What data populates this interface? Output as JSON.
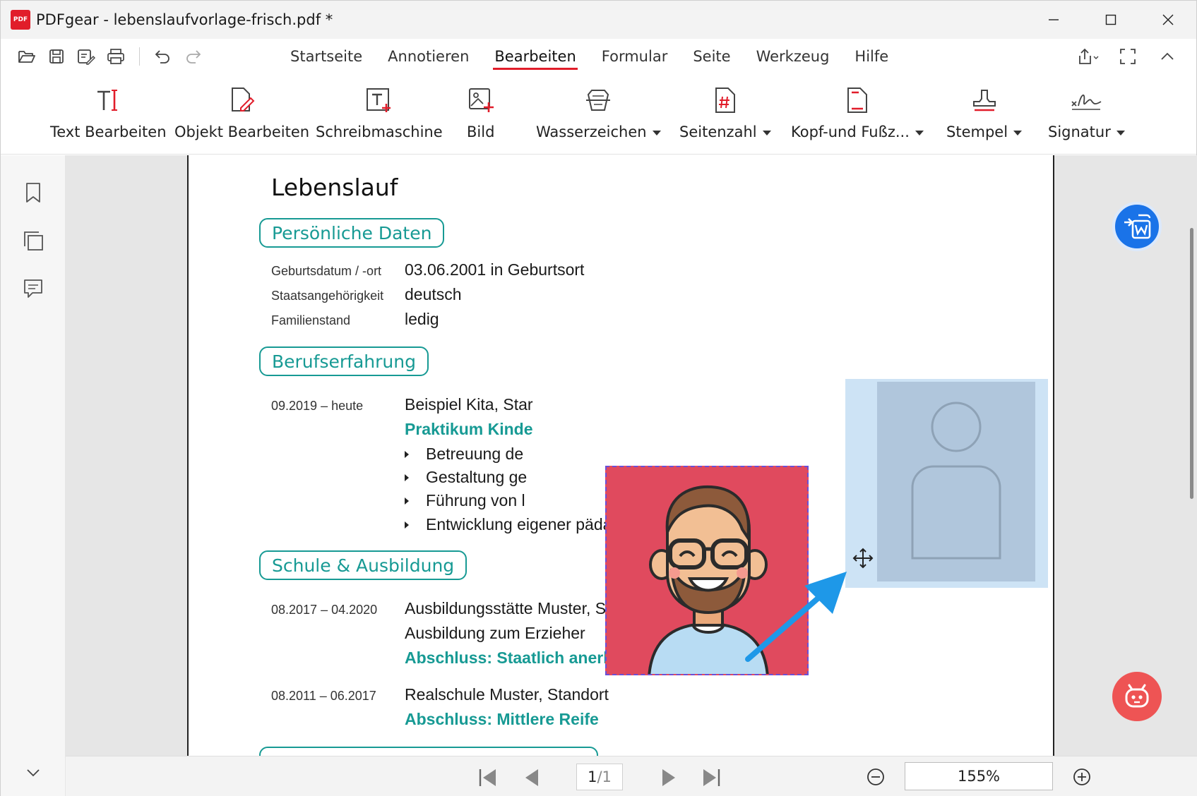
{
  "window": {
    "app_logo_text": "PDF",
    "title": "PDFgear - lebenslaufvorlage-frisch.pdf *"
  },
  "menu": {
    "items": [
      "Startseite",
      "Annotieren",
      "Bearbeiten",
      "Formular",
      "Seite",
      "Werkzeug",
      "Hilfe"
    ],
    "active": "Bearbeiten"
  },
  "ribbon": {
    "text_edit": "Text Bearbeiten",
    "object_edit": "Objekt Bearbeiten",
    "typewriter": "Schreibmaschine",
    "image": "Bild",
    "watermark": "Wasserzeichen",
    "page_number": "Seitenzahl",
    "header_footer": "Kopf-und Fußz...",
    "stamp": "Stempel",
    "signature": "Signatur"
  },
  "doc": {
    "title": "Lebenslauf",
    "personal": {
      "heading": "Persönliche Daten",
      "rows": [
        {
          "label": "Geburtsdatum / -ort",
          "value": "03.06.2001 in Geburtsort"
        },
        {
          "label": "Staatsangehörigkeit",
          "value": "deutsch"
        },
        {
          "label": "Familienstand",
          "value": "ledig"
        }
      ]
    },
    "experience": {
      "heading": "Berufserfahrung",
      "date": "09.2019 – heute",
      "employer": "Beispiel Kita, Star",
      "role": "Praktikum Kinde",
      "bullets": [
        "Betreuung de",
        "Gestaltung ge",
        "Führung von l",
        "Entwicklung eigener pädagogischer Konzepte"
      ]
    },
    "education": {
      "heading": "Schule & Ausbildung",
      "entries": [
        {
          "date": "08.2017 – 04.2020",
          "line1": "Ausbildungsstätte Muster, Standort",
          "line2": "Ausbildung zum Erzieher",
          "result": "Abschluss: Staatlich anerkannter Erzieher"
        },
        {
          "date": "08.2011 – 06.2017",
          "line1": "Realschule Muster, Standort",
          "result": "Abschluss: Mittlere Reife"
        }
      ]
    }
  },
  "footer": {
    "page_current": "1",
    "page_total": "/1",
    "zoom": "155%"
  },
  "colors": {
    "accent_red": "#e11d2a",
    "teal": "#179a94",
    "photo_bg": "#e04a5e",
    "placeholder_bg": "#cde3f5",
    "word_fab": "#1a73e8",
    "ai_fab": "#ee5454"
  },
  "icons": [
    "open-icon",
    "save-icon",
    "save-as-icon",
    "print-icon",
    "undo-icon",
    "redo-icon",
    "share-icon",
    "fullscreen-icon",
    "collapse-icon",
    "bookmark-icon",
    "pages-icon",
    "comment-icon",
    "convert-word-icon",
    "ai-assistant-icon",
    "move-icon"
  ]
}
